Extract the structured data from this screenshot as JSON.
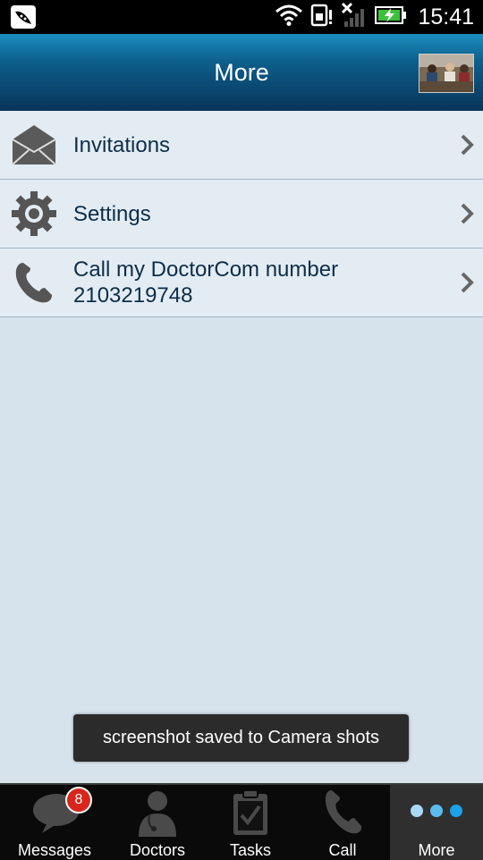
{
  "status_bar": {
    "time": "15:41",
    "icons": [
      "notification-icon",
      "wifi-icon",
      "sim-alert-icon",
      "no-signal-icon",
      "battery-charging-icon"
    ]
  },
  "header": {
    "title": "More",
    "avatar_icon": "user-photo"
  },
  "menu": {
    "items": [
      {
        "label": "Invitations",
        "icon": "envelope-icon"
      },
      {
        "label": "Settings",
        "icon": "gear-icon"
      },
      {
        "label_line1": "Call my DoctorCom number",
        "label_line2": "2103219748",
        "icon": "phone-icon"
      }
    ]
  },
  "toast": {
    "text": "screenshot saved to Camera shots"
  },
  "tabs": {
    "items": [
      {
        "label": "Messages",
        "badge": "8",
        "icon": "chat-bubble-icon"
      },
      {
        "label": "Doctors",
        "icon": "doctor-icon"
      },
      {
        "label": "Tasks",
        "icon": "checklist-icon"
      },
      {
        "label": "Call",
        "icon": "phone-icon"
      },
      {
        "label": "More",
        "icon": "dots-icon",
        "active": true
      }
    ]
  },
  "colors": {
    "header_top": "#1a8fbf",
    "header_bottom": "#08345a",
    "list_bg": "#e3ecf3",
    "page_bg": "#d6e3ec",
    "badge": "#d8261c",
    "dots_accent": "#1aa3e8"
  }
}
